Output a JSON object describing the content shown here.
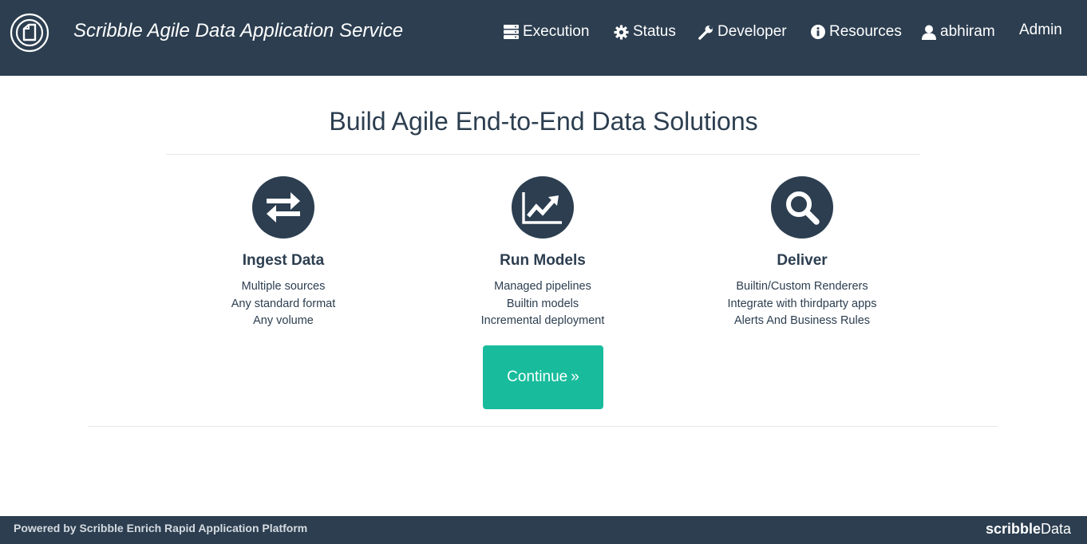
{
  "header": {
    "brand": "Scribble Agile Data Application Service",
    "nav": {
      "execution": "Execution",
      "status": "Status",
      "developer": "Developer",
      "resources": "Resources",
      "user": "abhiram",
      "admin": "Admin"
    }
  },
  "main": {
    "headline": "Build Agile End-to-End Data Solutions",
    "features": [
      {
        "icon": "exchange-arrows-icon",
        "title": "Ingest Data",
        "lines": [
          "Multiple sources",
          "Any standard format",
          "Any volume"
        ]
      },
      {
        "icon": "line-chart-icon",
        "title": "Run Models",
        "lines": [
          "Managed pipelines",
          "Builtin models",
          "Incremental deployment"
        ]
      },
      {
        "icon": "search-icon",
        "title": "Deliver",
        "lines": [
          "Builtin/Custom Renderers",
          "Integrate with thirdparty apps",
          "Alerts And Business Rules"
        ]
      }
    ],
    "continue_label": "Continue",
    "continue_chevron": "»"
  },
  "footer": {
    "text": "Powered by Scribble Enrich Rapid Application Platform",
    "brand_bold": "scribble",
    "brand_light": "Data"
  },
  "colors": {
    "navbar": "#2c3e50",
    "accent": "#18bc9c",
    "text": "#2c3e50"
  }
}
